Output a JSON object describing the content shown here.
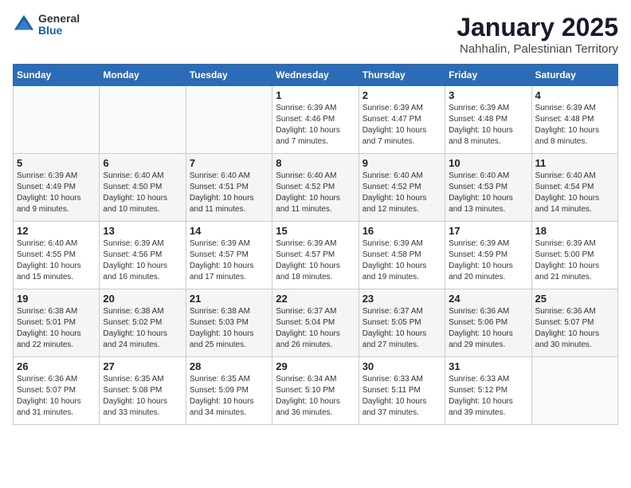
{
  "logo": {
    "general": "General",
    "blue": "Blue"
  },
  "title": "January 2025",
  "subtitle": "Nahhalin, Palestinian Territory",
  "headers": [
    "Sunday",
    "Monday",
    "Tuesday",
    "Wednesday",
    "Thursday",
    "Friday",
    "Saturday"
  ],
  "weeks": [
    [
      {
        "day": "",
        "sunrise": "",
        "sunset": "",
        "daylight": ""
      },
      {
        "day": "",
        "sunrise": "",
        "sunset": "",
        "daylight": ""
      },
      {
        "day": "",
        "sunrise": "",
        "sunset": "",
        "daylight": ""
      },
      {
        "day": "1",
        "sunrise": "Sunrise: 6:39 AM",
        "sunset": "Sunset: 4:46 PM",
        "daylight": "Daylight: 10 hours and 7 minutes."
      },
      {
        "day": "2",
        "sunrise": "Sunrise: 6:39 AM",
        "sunset": "Sunset: 4:47 PM",
        "daylight": "Daylight: 10 hours and 7 minutes."
      },
      {
        "day": "3",
        "sunrise": "Sunrise: 6:39 AM",
        "sunset": "Sunset: 4:48 PM",
        "daylight": "Daylight: 10 hours and 8 minutes."
      },
      {
        "day": "4",
        "sunrise": "Sunrise: 6:39 AM",
        "sunset": "Sunset: 4:48 PM",
        "daylight": "Daylight: 10 hours and 8 minutes."
      }
    ],
    [
      {
        "day": "5",
        "sunrise": "Sunrise: 6:39 AM",
        "sunset": "Sunset: 4:49 PM",
        "daylight": "Daylight: 10 hours and 9 minutes."
      },
      {
        "day": "6",
        "sunrise": "Sunrise: 6:40 AM",
        "sunset": "Sunset: 4:50 PM",
        "daylight": "Daylight: 10 hours and 10 minutes."
      },
      {
        "day": "7",
        "sunrise": "Sunrise: 6:40 AM",
        "sunset": "Sunset: 4:51 PM",
        "daylight": "Daylight: 10 hours and 11 minutes."
      },
      {
        "day": "8",
        "sunrise": "Sunrise: 6:40 AM",
        "sunset": "Sunset: 4:52 PM",
        "daylight": "Daylight: 10 hours and 11 minutes."
      },
      {
        "day": "9",
        "sunrise": "Sunrise: 6:40 AM",
        "sunset": "Sunset: 4:52 PM",
        "daylight": "Daylight: 10 hours and 12 minutes."
      },
      {
        "day": "10",
        "sunrise": "Sunrise: 6:40 AM",
        "sunset": "Sunset: 4:53 PM",
        "daylight": "Daylight: 10 hours and 13 minutes."
      },
      {
        "day": "11",
        "sunrise": "Sunrise: 6:40 AM",
        "sunset": "Sunset: 4:54 PM",
        "daylight": "Daylight: 10 hours and 14 minutes."
      }
    ],
    [
      {
        "day": "12",
        "sunrise": "Sunrise: 6:40 AM",
        "sunset": "Sunset: 4:55 PM",
        "daylight": "Daylight: 10 hours and 15 minutes."
      },
      {
        "day": "13",
        "sunrise": "Sunrise: 6:39 AM",
        "sunset": "Sunset: 4:56 PM",
        "daylight": "Daylight: 10 hours and 16 minutes."
      },
      {
        "day": "14",
        "sunrise": "Sunrise: 6:39 AM",
        "sunset": "Sunset: 4:57 PM",
        "daylight": "Daylight: 10 hours and 17 minutes."
      },
      {
        "day": "15",
        "sunrise": "Sunrise: 6:39 AM",
        "sunset": "Sunset: 4:57 PM",
        "daylight": "Daylight: 10 hours and 18 minutes."
      },
      {
        "day": "16",
        "sunrise": "Sunrise: 6:39 AM",
        "sunset": "Sunset: 4:58 PM",
        "daylight": "Daylight: 10 hours and 19 minutes."
      },
      {
        "day": "17",
        "sunrise": "Sunrise: 6:39 AM",
        "sunset": "Sunset: 4:59 PM",
        "daylight": "Daylight: 10 hours and 20 minutes."
      },
      {
        "day": "18",
        "sunrise": "Sunrise: 6:39 AM",
        "sunset": "Sunset: 5:00 PM",
        "daylight": "Daylight: 10 hours and 21 minutes."
      }
    ],
    [
      {
        "day": "19",
        "sunrise": "Sunrise: 6:38 AM",
        "sunset": "Sunset: 5:01 PM",
        "daylight": "Daylight: 10 hours and 22 minutes."
      },
      {
        "day": "20",
        "sunrise": "Sunrise: 6:38 AM",
        "sunset": "Sunset: 5:02 PM",
        "daylight": "Daylight: 10 hours and 24 minutes."
      },
      {
        "day": "21",
        "sunrise": "Sunrise: 6:38 AM",
        "sunset": "Sunset: 5:03 PM",
        "daylight": "Daylight: 10 hours and 25 minutes."
      },
      {
        "day": "22",
        "sunrise": "Sunrise: 6:37 AM",
        "sunset": "Sunset: 5:04 PM",
        "daylight": "Daylight: 10 hours and 26 minutes."
      },
      {
        "day": "23",
        "sunrise": "Sunrise: 6:37 AM",
        "sunset": "Sunset: 5:05 PM",
        "daylight": "Daylight: 10 hours and 27 minutes."
      },
      {
        "day": "24",
        "sunrise": "Sunrise: 6:36 AM",
        "sunset": "Sunset: 5:06 PM",
        "daylight": "Daylight: 10 hours and 29 minutes."
      },
      {
        "day": "25",
        "sunrise": "Sunrise: 6:36 AM",
        "sunset": "Sunset: 5:07 PM",
        "daylight": "Daylight: 10 hours and 30 minutes."
      }
    ],
    [
      {
        "day": "26",
        "sunrise": "Sunrise: 6:36 AM",
        "sunset": "Sunset: 5:07 PM",
        "daylight": "Daylight: 10 hours and 31 minutes."
      },
      {
        "day": "27",
        "sunrise": "Sunrise: 6:35 AM",
        "sunset": "Sunset: 5:08 PM",
        "daylight": "Daylight: 10 hours and 33 minutes."
      },
      {
        "day": "28",
        "sunrise": "Sunrise: 6:35 AM",
        "sunset": "Sunset: 5:09 PM",
        "daylight": "Daylight: 10 hours and 34 minutes."
      },
      {
        "day": "29",
        "sunrise": "Sunrise: 6:34 AM",
        "sunset": "Sunset: 5:10 PM",
        "daylight": "Daylight: 10 hours and 36 minutes."
      },
      {
        "day": "30",
        "sunrise": "Sunrise: 6:33 AM",
        "sunset": "Sunset: 5:11 PM",
        "daylight": "Daylight: 10 hours and 37 minutes."
      },
      {
        "day": "31",
        "sunrise": "Sunrise: 6:33 AM",
        "sunset": "Sunset: 5:12 PM",
        "daylight": "Daylight: 10 hours and 39 minutes."
      },
      {
        "day": "",
        "sunrise": "",
        "sunset": "",
        "daylight": ""
      }
    ]
  ]
}
